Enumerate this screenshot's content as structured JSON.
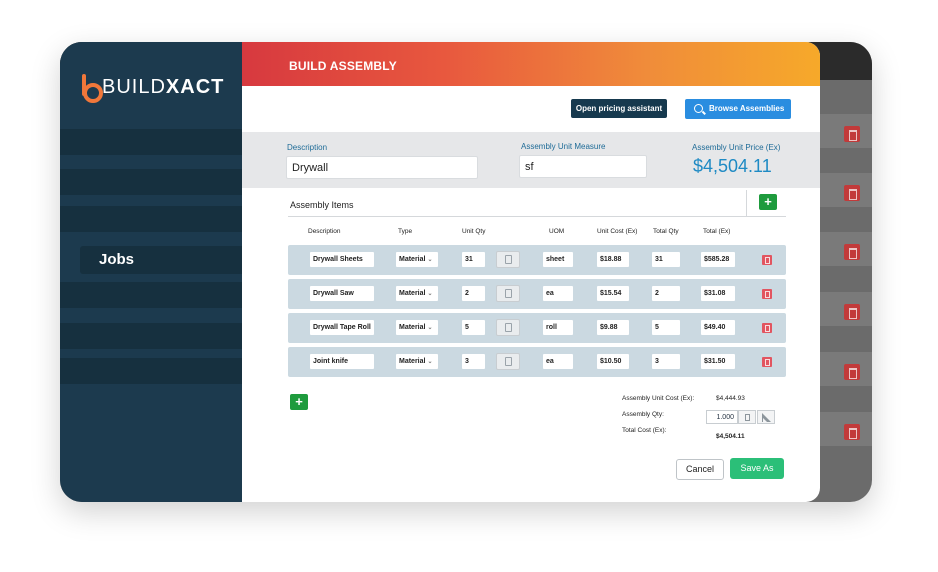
{
  "brand": {
    "logo_light": "BUILD",
    "logo_bold": "XACT"
  },
  "sidebar": {
    "active_item": "Jobs"
  },
  "modal": {
    "title": "BUILD ASSEMBLY",
    "pricing_button": "Open pricing assistant",
    "browse_button": "Browse Assemblies",
    "description_label": "Description",
    "description_value": "Drywall",
    "unit_measure_label": "Assembly Unit Measure",
    "unit_measure_value": "sf",
    "unit_price_label": "Assembly Unit Price (Ex)",
    "unit_price_value": "$4,504.11",
    "items_title": "Assembly Items",
    "add_symbol": "+",
    "columns": [
      "Description",
      "Type",
      "Unit Qty",
      "UOM",
      "Unit Cost (Ex)",
      "Total Qty",
      "Total (Ex)"
    ],
    "rows": [
      {
        "description": "Drywall Sheets",
        "type": "Material",
        "unit_qty": "31",
        "uom": "sheet",
        "unit_cost": "$18.88",
        "total_qty": "31",
        "total": "$585.28"
      },
      {
        "description": "Drywall Saw",
        "type": "Material",
        "unit_qty": "2",
        "uom": "ea",
        "unit_cost": "$15.54",
        "total_qty": "2",
        "total": "$31.08"
      },
      {
        "description": "Drywall Tape Roll",
        "type": "Material",
        "unit_qty": "5",
        "uom": "roll",
        "unit_cost": "$9.88",
        "total_qty": "5",
        "total": "$49.40"
      },
      {
        "description": "Joint knife",
        "type": "Material",
        "unit_qty": "3",
        "uom": "ea",
        "unit_cost": "$10.50",
        "total_qty": "3",
        "total": "$31.50"
      }
    ],
    "summary": {
      "unit_cost_label": "Assembly Unit Cost (Ex):",
      "unit_cost_value": "$4,444.93",
      "qty_label": "Assembly Qty:",
      "qty_value": "1.000",
      "total_label": "Total Cost (Ex):",
      "total_value": "$4,504.11"
    },
    "cancel_button": "Cancel",
    "save_button": "Save As"
  },
  "colors": {
    "sidebar": "#1c3a4e",
    "header_gradient_start": "#d7393f",
    "header_gradient_end": "#f6a92a",
    "accent_blue": "#2a8de0",
    "price_blue": "#1e8ac4",
    "add_green": "#1e9b3d",
    "save_green": "#2bbf78",
    "delete_red": "#e25560"
  }
}
